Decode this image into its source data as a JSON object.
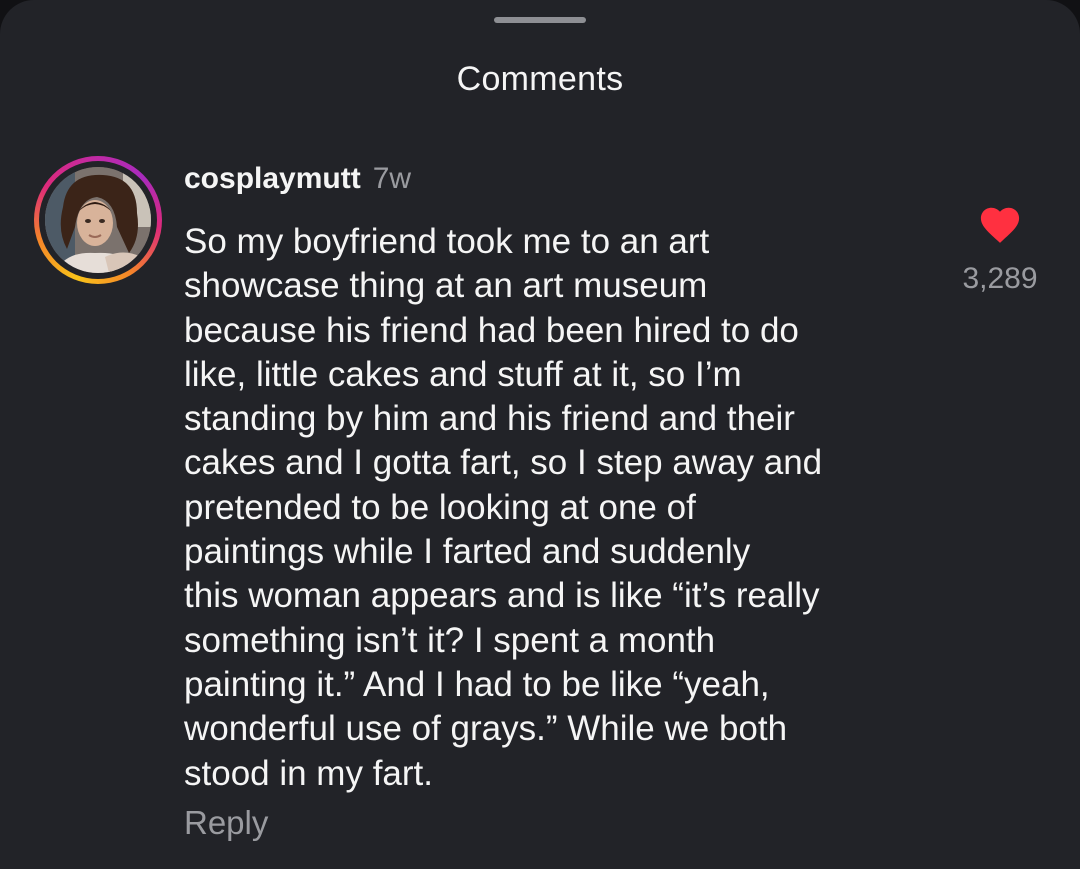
{
  "sheet": {
    "title": "Comments"
  },
  "comment": {
    "username": "cosplaymutt",
    "timestamp": "7w",
    "text": "So my boyfriend took me to an art\nshowcase thing at an art museum\nbecause his friend had been hired to do\nlike, little cakes and stuff at it, so I’m\nstanding by him and his friend and their\ncakes and I gotta fart, so I step away and\npretended to be looking at one of\npaintings while I farted and suddenly\nthis woman appears and is like “it’s really\nsomething isn’t it? I spent a month\npainting it.” And I had to be like “yeah,\nwonderful use of grays.” While we both\nstood in my fart.",
    "like_count": "3,289",
    "reply_label": "Reply",
    "liked": true,
    "story_ring": true
  },
  "colors": {
    "background": "#222328",
    "heart": "#ff3040",
    "primary_text": "#f5f5f5",
    "secondary_text": "#9a9ba0"
  },
  "icons": {
    "like": "heart-icon",
    "avatar": "avatar"
  }
}
